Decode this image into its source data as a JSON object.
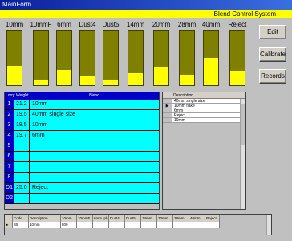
{
  "window": {
    "title": "MainForm"
  },
  "banner": {
    "text": "Blend Control System"
  },
  "bins": [
    {
      "label": "10mm",
      "level": 0.36
    },
    {
      "label": "10mmF",
      "level": 0.1
    },
    {
      "label": "6mm",
      "level": 0.28
    },
    {
      "label": "Dust4",
      "level": 0.17
    },
    {
      "label": "Dust5",
      "level": 0.11
    },
    {
      "label": "14mm",
      "level": 0.22
    },
    {
      "label": "20mm",
      "level": 0.33
    },
    {
      "label": "28mm",
      "level": 0.19
    },
    {
      "label": "40mm",
      "level": 0.5
    },
    {
      "label": "Reject",
      "level": 0.26
    }
  ],
  "buttons": {
    "edit": "Edit",
    "calibrate": "Calibrate",
    "records": "Records"
  },
  "lorry_grid": {
    "headers": [
      "Lorry",
      "Weight",
      "Blend"
    ],
    "rows": [
      {
        "lorry": "1",
        "weight": "21.2",
        "blend": "10mm"
      },
      {
        "lorry": "2",
        "weight": "19.5",
        "blend": "40mm single size"
      },
      {
        "lorry": "3",
        "weight": "18.5",
        "blend": "10mm"
      },
      {
        "lorry": "4",
        "weight": "19.7",
        "blend": "6mm"
      },
      {
        "lorry": "5",
        "weight": "",
        "blend": ""
      },
      {
        "lorry": "6",
        "weight": "",
        "blend": ""
      },
      {
        "lorry": "7",
        "weight": "",
        "blend": ""
      },
      {
        "lorry": "8",
        "weight": "",
        "blend": ""
      },
      {
        "lorry": "D1",
        "weight": "25.0",
        "blend": "Reject"
      },
      {
        "lorry": "D2",
        "weight": "",
        "blend": ""
      }
    ]
  },
  "description_list": {
    "header": "Description",
    "current_marker": "▶",
    "items": [
      "40mm single size",
      "10mm flake",
      "6mm",
      "Reject",
      "10mm"
    ]
  },
  "bottom_grid": {
    "headers": [
      "Code",
      "Description",
      "10mm tph",
      "10mmF tph",
      "6mm tph",
      "Dust4 tph",
      "Dust5 tph",
      "14mm tph",
      "20mm tph",
      "28mm tph",
      "40mm tph",
      "Reject"
    ],
    "row": [
      "S5",
      "10mm",
      "800",
      "",
      "",
      "",
      "",
      "",
      "",
      "",
      "",
      ""
    ],
    "current_marker": "▶"
  },
  "colors": {
    "bin_body": "#808000",
    "bin_fill": "#ffff00",
    "grid_cell": "#00ffff",
    "grid_header": "#0000c8"
  }
}
